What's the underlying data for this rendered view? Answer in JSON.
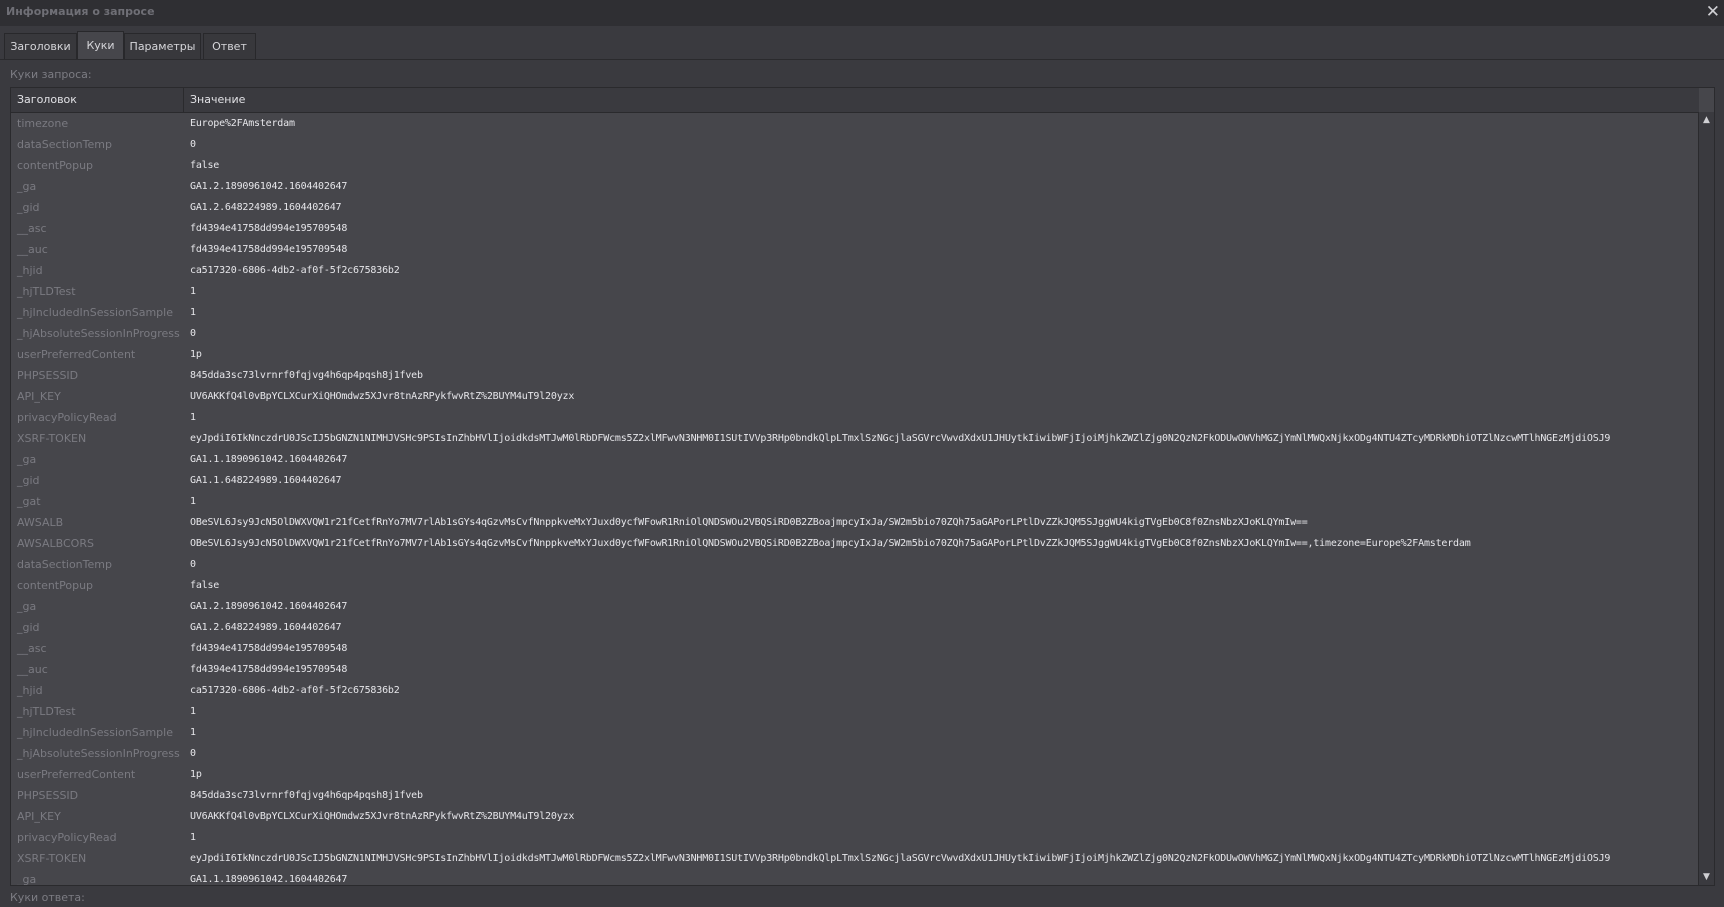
{
  "window": {
    "title": "Информация о запросе",
    "close_glyph": "✕"
  },
  "tabs": [
    {
      "label": "Заголовки"
    },
    {
      "label": "Куки"
    },
    {
      "label": "Параметры"
    },
    {
      "label": "Ответ"
    }
  ],
  "active_tab": "Куки",
  "request_cookies_label": "Куки запроса:",
  "response_cookies_label": "Куки ответа:",
  "table": {
    "headers": [
      "Заголовок",
      "Значение"
    ],
    "rows": [
      [
        "timezone",
        "Europe%2FAmsterdam"
      ],
      [
        "dataSectionTemp",
        "0"
      ],
      [
        "contentPopup",
        "false"
      ],
      [
        "_ga",
        "GA1.2.1890961042.1604402647"
      ],
      [
        "_gid",
        "GA1.2.648224989.1604402647"
      ],
      [
        "__asc",
        "fd4394e41758dd994e195709548"
      ],
      [
        "__auc",
        "fd4394e41758dd994e195709548"
      ],
      [
        "_hjid",
        "ca517320-6806-4db2-af0f-5f2c675836b2"
      ],
      [
        "_hjTLDTest",
        "1"
      ],
      [
        "_hjIncludedInSessionSample",
        "1"
      ],
      [
        "_hjAbsoluteSessionInProgress",
        "0"
      ],
      [
        "userPreferredContent",
        "1p"
      ],
      [
        "PHPSESSID",
        "845dda3sc73lvrnrf0fqjvg4h6qp4pqsh8j1fveb"
      ],
      [
        "API_KEY",
        "UV6AKKfQ4l0vBpYCLXCurXiQHOmdwz5XJvr8tnAzRPykfwvRtZ%2BUYM4uT9l20yzx"
      ],
      [
        "privacyPolicyRead",
        "1"
      ],
      [
        "XSRF-TOKEN",
        "eyJpdiI6IkNnczdrU0JScIJ5bGNZN1NIMHJVSHc9PSIsInZhbHVlIjoidkdsMTJwM0lRbDFWcms5Z2xlMFwvN3NHM0I1SUtIVVp3RHp0bndkQlpLTmxlSzNGcjlaSGVrcVwvdXdxU1JHUytkIiwibWFjIjoiMjhkZWZlZjg0N2QzN2FkODUwOWVhMGZjYmNlMWQxNjkxODg4NTU4ZTcyMDRkMDhiOTZlNzcwMTlhNGEzMjdiOSJ9"
      ],
      [
        "_ga",
        "GA1.1.1890961042.1604402647"
      ],
      [
        "_gid",
        "GA1.1.648224989.1604402647"
      ],
      [
        "_gat",
        "1"
      ],
      [
        "AWSALB",
        "OBeSVL6Jsy9JcN5OlDWXVQW1r21fCetfRnYo7MV7rlAb1sGYs4qGzvMsCvfNnppkveMxYJuxd0ycfWFowR1RniOlQNDSWOu2VBQSiRD0B2ZBoajmpcyIxJa/SW2m5bio70ZQh75aGAPorLPtlDvZZkJQM5SJggWU4kigTVgEb0C8f0ZnsNbzXJoKLQYmIw=="
      ],
      [
        "AWSALBCORS",
        "OBeSVL6Jsy9JcN5OlDWXVQW1r21fCetfRnYo7MV7rlAb1sGYs4qGzvMsCvfNnppkveMxYJuxd0ycfWFowR1RniOlQNDSWOu2VBQSiRD0B2ZBoajmpcyIxJa/SW2m5bio70ZQh75aGAPorLPtlDvZZkJQM5SJggWU4kigTVgEb0C8f0ZnsNbzXJoKLQYmIw==,timezone=Europe%2FAmsterdam"
      ],
      [
        "dataSectionTemp",
        "0"
      ],
      [
        "contentPopup",
        "false"
      ],
      [
        "_ga",
        "GA1.2.1890961042.1604402647"
      ],
      [
        "_gid",
        "GA1.2.648224989.1604402647"
      ],
      [
        "__asc",
        "fd4394e41758dd994e195709548"
      ],
      [
        "__auc",
        "fd4394e41758dd994e195709548"
      ],
      [
        "_hjid",
        "ca517320-6806-4db2-af0f-5f2c675836b2"
      ],
      [
        "_hjTLDTest",
        "1"
      ],
      [
        "_hjIncludedInSessionSample",
        "1"
      ],
      [
        "_hjAbsoluteSessionInProgress",
        "0"
      ],
      [
        "userPreferredContent",
        "1p"
      ],
      [
        "PHPSESSID",
        "845dda3sc73lvrnrf0fqjvg4h6qp4pqsh8j1fveb"
      ],
      [
        "API_KEY",
        "UV6AKKfQ4l0vBpYCLXCurXiQHOmdwz5XJvr8tnAzRPykfwvRtZ%2BUYM4uT9l20yzx"
      ],
      [
        "privacyPolicyRead",
        "1"
      ],
      [
        "XSRF-TOKEN",
        "eyJpdiI6IkNnczdrU0JScIJ5bGNZN1NIMHJVSHc9PSIsInZhbHVlIjoidkdsMTJwM0lRbDFWcms5Z2xlMFwvN3NHM0I1SUtIVVp3RHp0bndkQlpLTmxlSzNGcjlaSGVrcVwvdXdxU1JHUytkIiwibWFjIjoiMjhkZWZlZjg0N2QzN2FkODUwOWVhMGZjYmNlMWQxNjkxODg4NTU4ZTcyMDRkMDhiOTZlNzcwMTlhNGEzMjdiOSJ9"
      ],
      [
        "_ga",
        "GA1.1.1890961042.1604402647"
      ]
    ]
  },
  "scrollbar": {
    "up_glyph": "▲",
    "down_glyph": "▼"
  },
  "colors": {
    "background": "#3a3a3f",
    "table_bg": "#46464b",
    "key_text": "#7a7a81",
    "value_text": "#e6e6ea"
  }
}
